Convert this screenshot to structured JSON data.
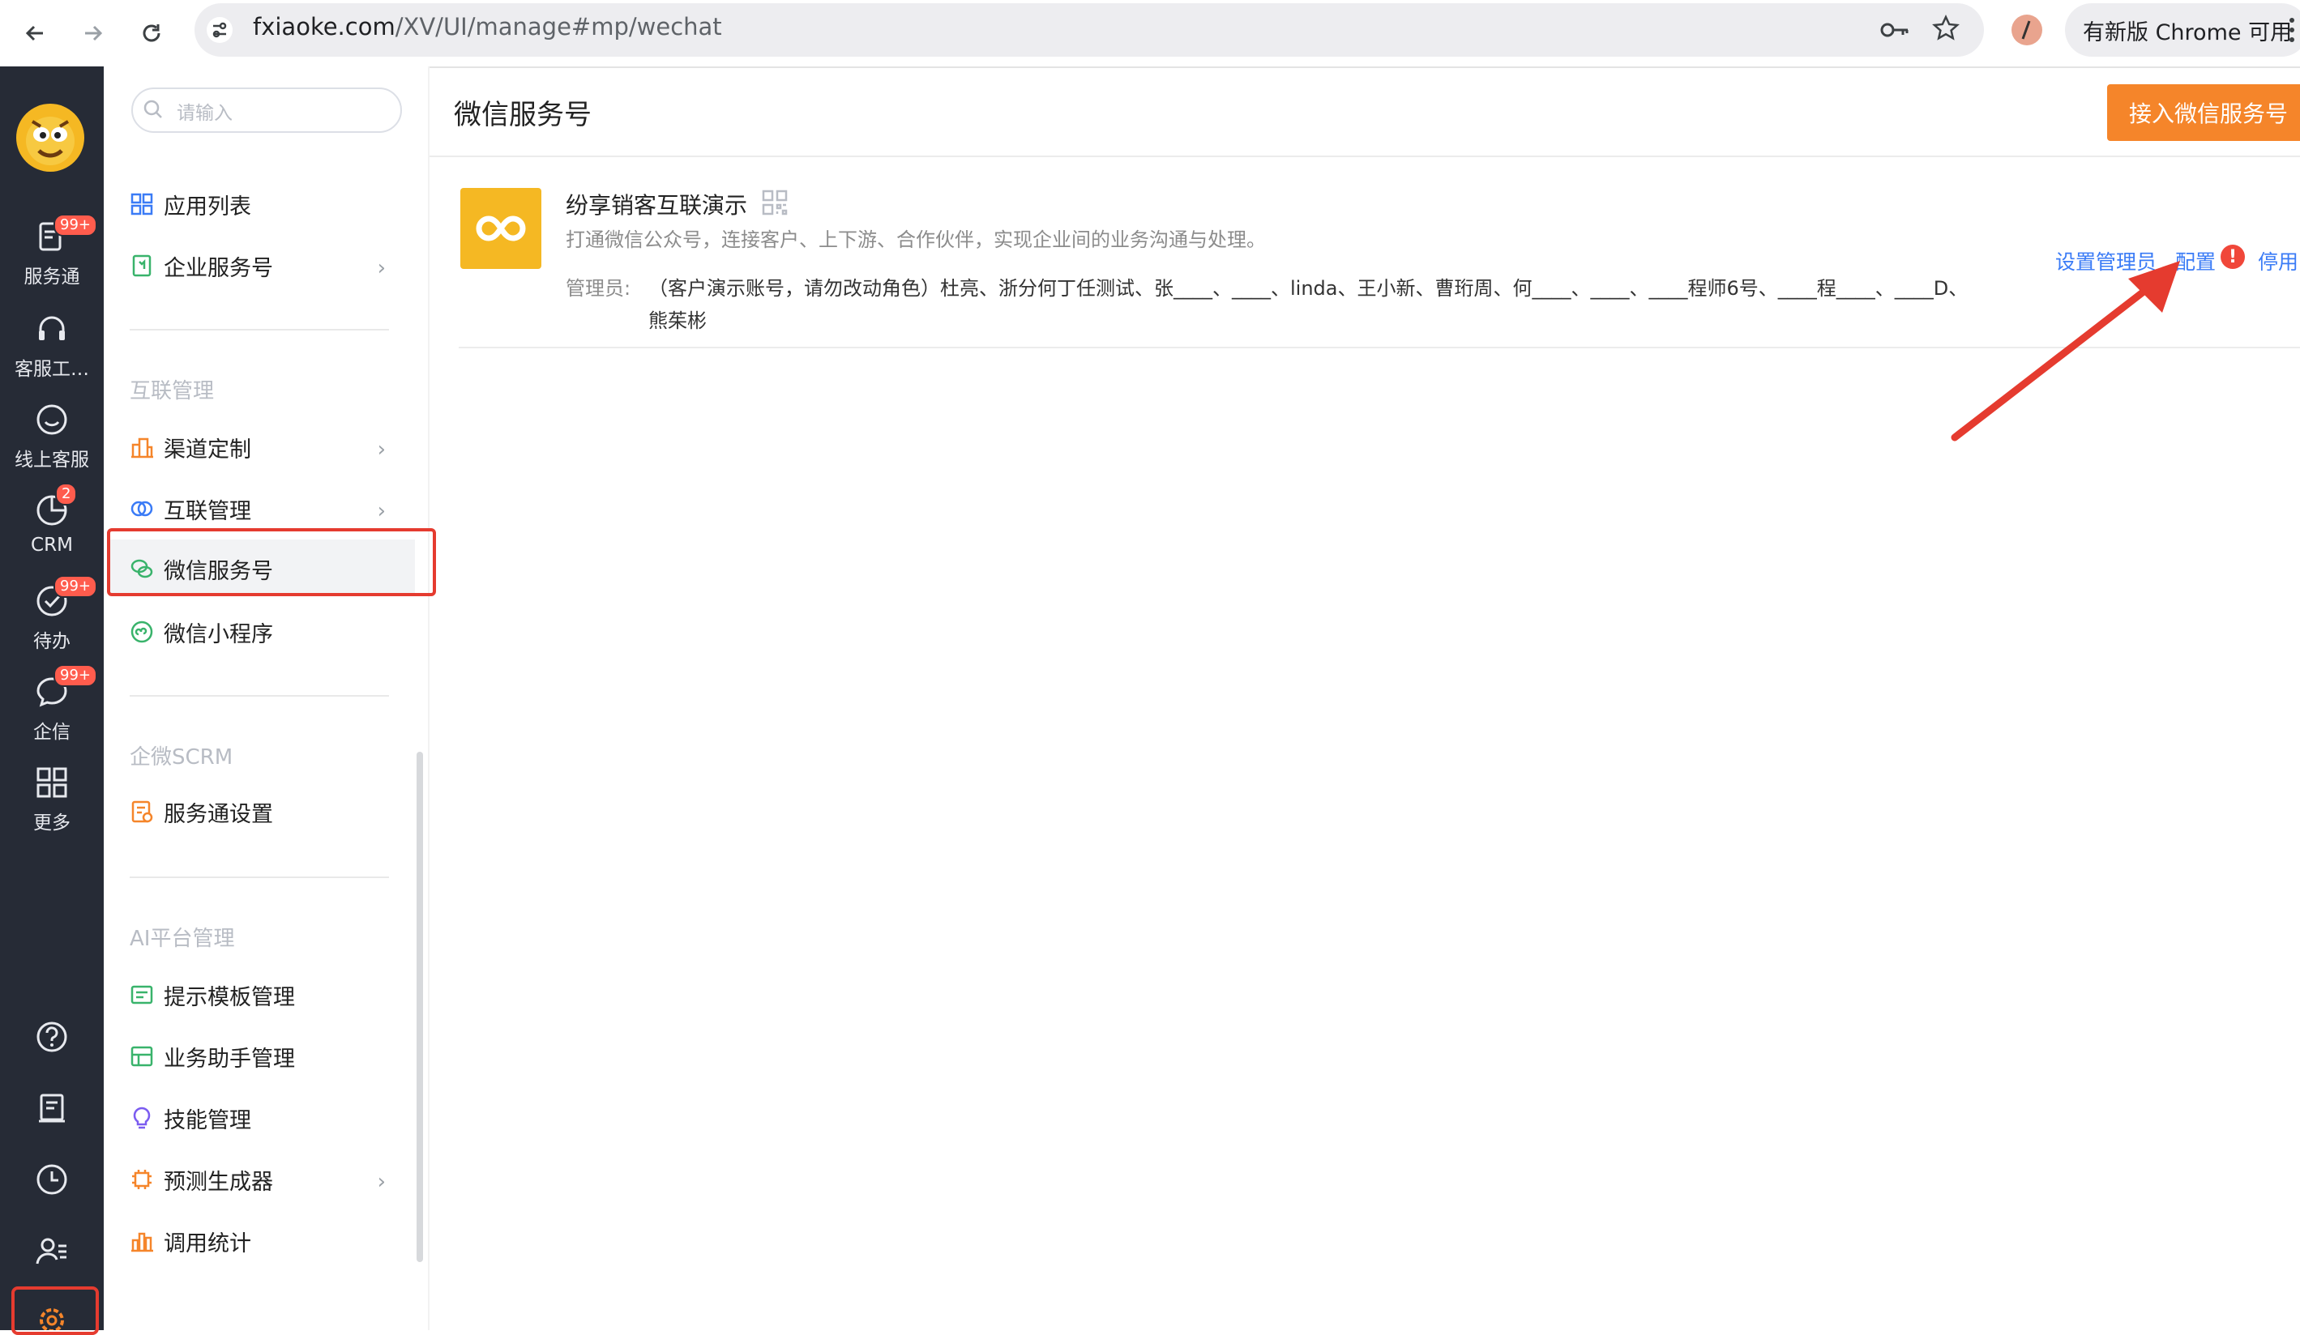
{
  "browser": {
    "url_host": "fxiaoke.com",
    "url_path": "/XV/UI/manage#mp/wechat",
    "update_label": "有新版 Chrome 可用"
  },
  "rail": {
    "items": [
      {
        "label": "服务通",
        "badge": "99+"
      },
      {
        "label": "客服工…",
        "badge": ""
      },
      {
        "label": "线上客服",
        "badge": ""
      },
      {
        "label": "CRM",
        "badge": "2"
      },
      {
        "label": "待办",
        "badge": "99+"
      },
      {
        "label": "企信",
        "badge": "99+"
      },
      {
        "label": "更多",
        "badge": ""
      }
    ]
  },
  "sidebar": {
    "search_placeholder": "请输入",
    "top_items": [
      {
        "label": "应用列表"
      },
      {
        "label": "企业服务号"
      }
    ],
    "groups": [
      {
        "title": "互联管理",
        "items": [
          {
            "label": "渠道定制"
          },
          {
            "label": "互联管理"
          },
          {
            "label": "微信服务号"
          },
          {
            "label": "微信小程序"
          }
        ]
      },
      {
        "title": "企微SCRM",
        "items": [
          {
            "label": "服务通设置"
          }
        ]
      },
      {
        "title": "AI平台管理",
        "items": [
          {
            "label": "提示模板管理"
          },
          {
            "label": "业务助手管理"
          },
          {
            "label": "技能管理"
          },
          {
            "label": "预测生成器"
          },
          {
            "label": "调用统计"
          }
        ]
      }
    ]
  },
  "main": {
    "title": "微信服务号",
    "connect_button": "接入微信服务号",
    "account": {
      "name": "纷享销客互联演示",
      "description": "打通微信公众号，连接客户、上下游、合作伙伴，实现企业间的业务沟通与处理。",
      "admins_label": "管理员:",
      "admins": "（客户演示账号，请勿改动角色）杜亮、浙分何丁任测试、张____、____、linda、王小新、曹珩周、何____、____、____程师6号、____程____、____D、熊茱彬",
      "actions": {
        "set_admin": "设置管理员",
        "config": "配置",
        "disable": "停用"
      }
    }
  },
  "colors": {
    "rail_bg": "#262b36",
    "accent_orange": "#f5852a",
    "link_blue": "#3a7bf6",
    "highlight_red": "#e53b2f",
    "logo_yellow": "#f5b823"
  }
}
